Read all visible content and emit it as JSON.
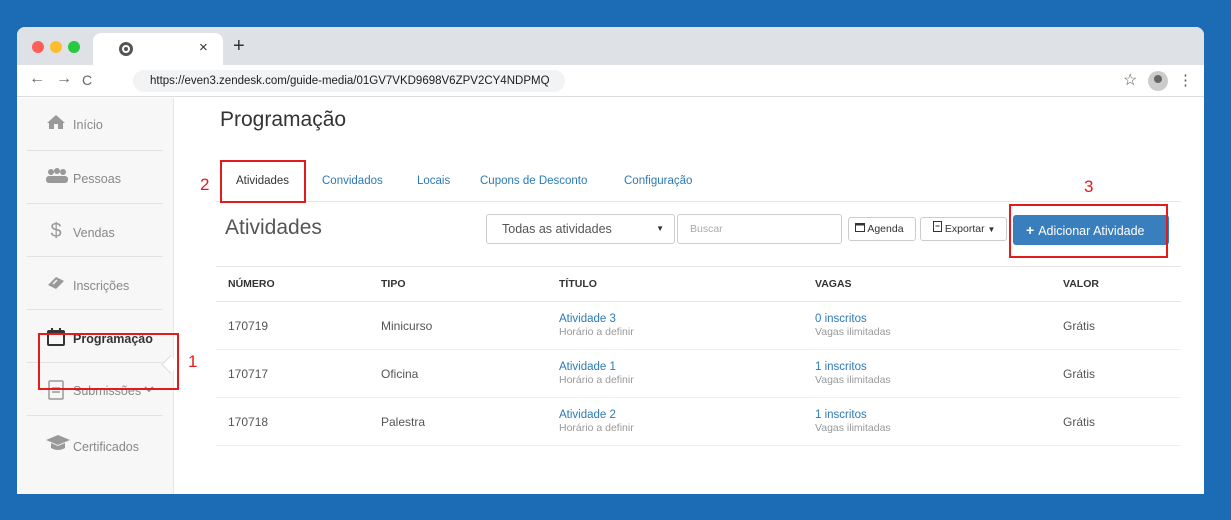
{
  "browser": {
    "url": "https://even3.zendesk.com/guide-media/01GV7VKD9698V6ZPV2CY4NDPMQ",
    "tab_close": "×",
    "new_tab": "+",
    "back": "←",
    "forward": "→",
    "reload": "C",
    "star": "☆",
    "menu": "⋮"
  },
  "sidebar": {
    "items": [
      {
        "label": "Início",
        "icon": "home-icon"
      },
      {
        "label": "Pessoas",
        "icon": "people-icon"
      },
      {
        "label": "Vendas",
        "icon": "dollar-icon",
        "glyph": "$"
      },
      {
        "label": "Inscrições",
        "icon": "ticket-icon"
      },
      {
        "label": "Programação",
        "icon": "calendar-icon"
      },
      {
        "label": "Submissões",
        "icon": "document-icon"
      },
      {
        "label": "Certificados",
        "icon": "graduation-cap-icon"
      }
    ]
  },
  "page": {
    "title": "Programação",
    "tabs": [
      "Atividades",
      "Convidados",
      "Locais",
      "Cupons de Desconto",
      "Configuração"
    ],
    "section_title": "Atividades",
    "filter_select": "Todas as atividades",
    "search_placeholder": "Buscar",
    "agenda_button": "Agenda",
    "export_button": "Exportar",
    "add_button": "Adicionar Atividade"
  },
  "table": {
    "columns": [
      "NÚMERO",
      "TIPO",
      "TÍTULO",
      "VAGAS",
      "VALOR"
    ],
    "rows": [
      {
        "numero": "170719",
        "tipo": "Minicurso",
        "titulo": "Atividade 3",
        "horario": "Horário a definir",
        "inscritos": "0 inscritos",
        "vagas": "Vagas ilimitadas",
        "valor": "Grátis"
      },
      {
        "numero": "170717",
        "tipo": "Oficina",
        "titulo": "Atividade 1",
        "horario": "Horário a definir",
        "inscritos": "1 inscritos",
        "vagas": "Vagas ilimitadas",
        "valor": "Grátis"
      },
      {
        "numero": "170718",
        "tipo": "Palestra",
        "titulo": "Atividade 2",
        "horario": "Horário a definir",
        "inscritos": "1 inscritos",
        "vagas": "Vagas ilimitadas",
        "valor": "Grátis"
      }
    ]
  },
  "annotations": {
    "n1": "1",
    "n2": "2",
    "n3": "3"
  },
  "colors": {
    "background": "#1b6bb5",
    "primary": "#3a7fbd",
    "link": "#2a7ab8",
    "annotation": "#e31b1b"
  }
}
